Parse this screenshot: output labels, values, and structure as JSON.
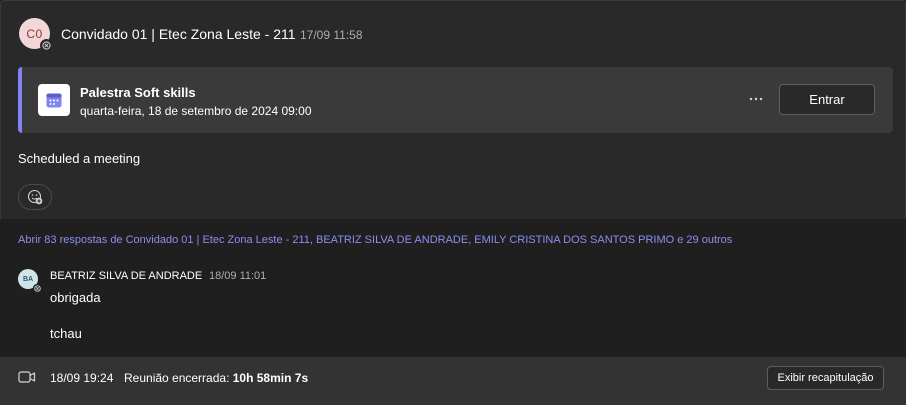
{
  "post": {
    "avatar_initials": "C0",
    "author": "Convidado 01 | Etec Zona Leste - 211",
    "timestamp": "17/09 11:58",
    "meeting": {
      "title": "Palestra Soft skills",
      "date": "quarta-feira, 18 de setembro de 2024 09:00",
      "more_label": "···",
      "join_label": "Entrar"
    },
    "message": "Scheduled a meeting",
    "icons": {
      "calendar": "calendar-icon",
      "avatar_status": "offline-icon",
      "more": "more-options-icon",
      "reaction": "add-reaction-icon"
    }
  },
  "replies": {
    "link_text": "Abrir 83 respostas de Convidado 01 | Etec Zona Leste - 211, BEATRIZ SILVA DE ANDRADE, EMILY CRISTINA DOS SANTOS PRIMO e 29 outros",
    "items": [
      {
        "avatar_initials": "BA",
        "author": "BEATRIZ SILVA DE ANDRADE",
        "time": "18/09 11:01",
        "messages": [
          "obrigada",
          "tchau"
        ]
      }
    ]
  },
  "footer": {
    "time": "18/09 19:24",
    "status_label": "Reunião encerrada:",
    "duration": "10h 58min 7s",
    "recap_label": "Exibir recapitulação",
    "icon": "video-camera-icon"
  },
  "colors": {
    "accent": "#7f85f5",
    "link": "#8b8ef2",
    "background": "#1f1f1f",
    "card": "#292929"
  }
}
